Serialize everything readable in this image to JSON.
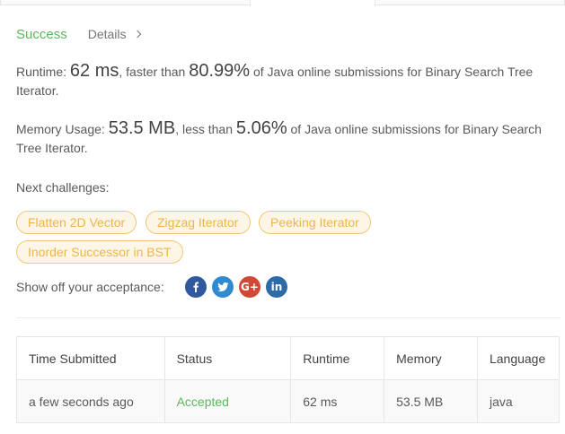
{
  "result": {
    "status": "Success",
    "details_label": "Details"
  },
  "runtime": {
    "prefix": "Runtime: ",
    "value": "62 ms",
    "middle": ", faster than ",
    "percent": "80.99%",
    "suffix": " of Java online submissions for Binary Search Tree Iterator."
  },
  "memory": {
    "prefix": "Memory Usage: ",
    "value": "53.5 MB",
    "middle": ", less than ",
    "percent": "5.06%",
    "suffix": " of Java online submissions for Binary Search Tree Iterator."
  },
  "next": {
    "label": "Next challenges:",
    "challenges": [
      "Flatten 2D Vector",
      "Zigzag Iterator",
      "Peeking Iterator",
      "Inorder Successor in BST"
    ]
  },
  "share": {
    "label": "Show off your acceptance:",
    "icons": [
      "facebook-icon",
      "twitter-icon",
      "google-plus-icon",
      "linkedin-icon"
    ]
  },
  "table": {
    "headers": [
      "Time Submitted",
      "Status",
      "Runtime",
      "Memory",
      "Language"
    ],
    "rows": [
      [
        "a few seconds ago",
        "Accepted",
        "62 ms",
        "53.5 MB",
        "java"
      ]
    ]
  },
  "colors": {
    "success": "#5cb85c",
    "chip_text": "#ecb54a",
    "chip_border": "#f0c879"
  }
}
